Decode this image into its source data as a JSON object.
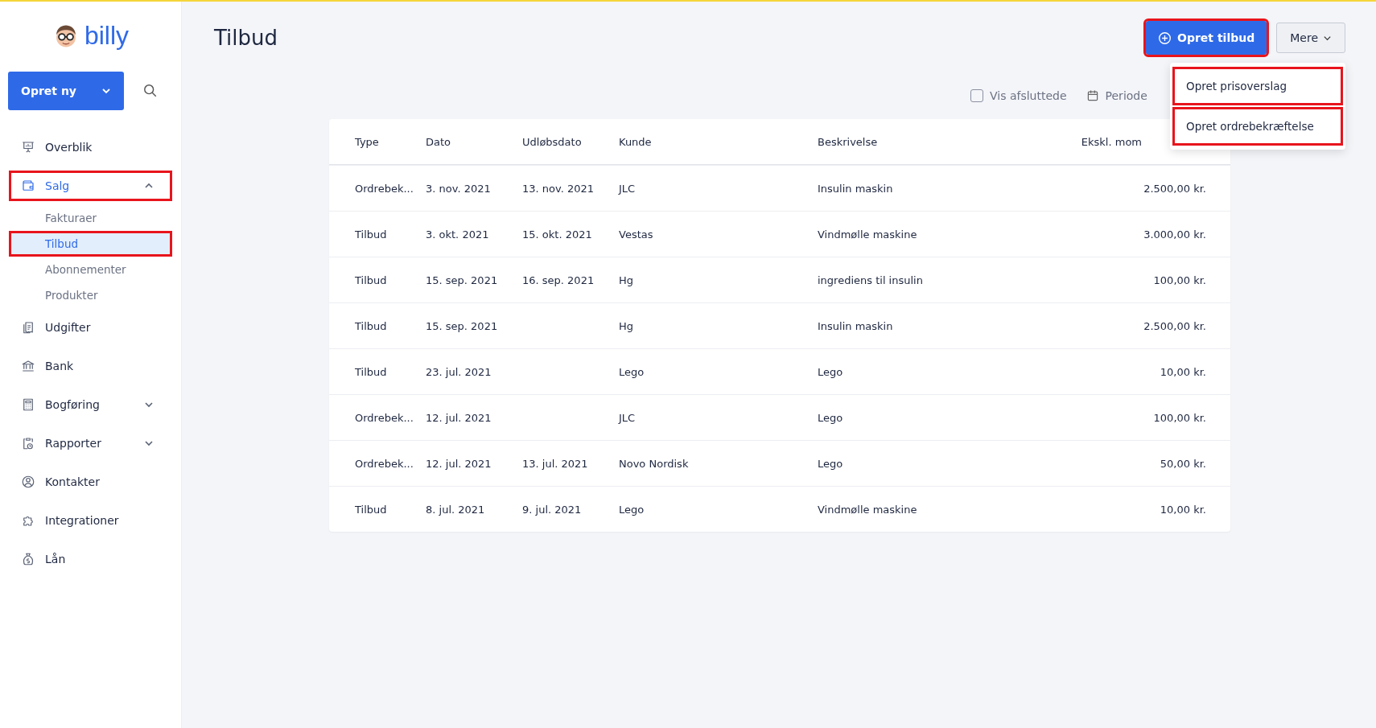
{
  "logo": {
    "text": "billy"
  },
  "create_button": {
    "label": "Opret ny"
  },
  "sidebar": {
    "items": [
      {
        "label": "Overblik",
        "selected": false,
        "highlighted": false
      },
      {
        "label": "Salg",
        "selected": true,
        "expanded": true,
        "highlighted": true,
        "children": [
          {
            "label": "Fakturaer",
            "selected": false,
            "highlighted": false
          },
          {
            "label": "Tilbud",
            "selected": true,
            "highlighted": true
          },
          {
            "label": "Abonnementer",
            "selected": false,
            "highlighted": false
          },
          {
            "label": "Produkter",
            "selected": false,
            "highlighted": false
          }
        ]
      },
      {
        "label": "Udgifter",
        "selected": false,
        "highlighted": false
      },
      {
        "label": "Bank",
        "selected": false,
        "highlighted": false
      },
      {
        "label": "Bogføring",
        "selected": false,
        "expanded": false,
        "highlighted": false
      },
      {
        "label": "Rapporter",
        "selected": false,
        "expanded": false,
        "highlighted": false
      },
      {
        "label": "Kontakter",
        "selected": false,
        "highlighted": false
      },
      {
        "label": "Integrationer",
        "selected": false,
        "highlighted": false
      },
      {
        "label": "Lån",
        "selected": false,
        "highlighted": false
      }
    ]
  },
  "page": {
    "title": "Tilbud"
  },
  "primary_button": {
    "label": "Opret tilbud",
    "highlighted": true
  },
  "more_button": {
    "label": "Mere"
  },
  "more_menu": {
    "items": [
      {
        "label": "Opret prisoverslag",
        "highlighted": true
      },
      {
        "label": "Opret ordrebekræftelse",
        "highlighted": true
      }
    ]
  },
  "filters": {
    "show_closed": {
      "label": "Vis afsluttede",
      "checked": false
    },
    "period": {
      "label": "Periode"
    }
  },
  "table": {
    "columns": [
      "Type",
      "Dato",
      "Udløbsdato",
      "Kunde",
      "Beskrivelse",
      "Ekskl. mom"
    ],
    "rows": [
      [
        "Ordrebek...",
        "3. nov. 2021",
        "13. nov. 2021",
        "JLC",
        "Insulin maskin",
        "2.500,00 kr."
      ],
      [
        "Tilbud",
        "3. okt. 2021",
        "15. okt. 2021",
        "Vestas",
        "Vindmølle maskine",
        "3.000,00 kr."
      ],
      [
        "Tilbud",
        "15. sep. 2021",
        "16. sep. 2021",
        "Hg",
        "ingrediens til insulin",
        "100,00 kr."
      ],
      [
        "Tilbud",
        "15. sep. 2021",
        "",
        "Hg",
        "Insulin maskin",
        "2.500,00 kr."
      ],
      [
        "Tilbud",
        "23. jul. 2021",
        "",
        "Lego",
        "Lego",
        "10,00 kr."
      ],
      [
        "Ordrebek...",
        "12. jul. 2021",
        "",
        "JLC",
        "Lego",
        "100,00 kr."
      ],
      [
        "Ordrebek...",
        "12. jul. 2021",
        "13. jul. 2021",
        "Novo Nordisk",
        "Lego",
        "50,00 kr."
      ],
      [
        "Tilbud",
        "8. jul. 2021",
        "9. jul. 2021",
        "Lego",
        "Vindmølle maskine",
        "10,00 kr."
      ]
    ]
  }
}
